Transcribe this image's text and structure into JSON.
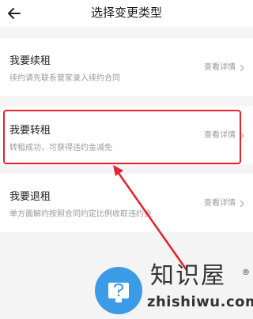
{
  "header": {
    "title": "选择变更类型",
    "back_icon": "arrow-left-icon"
  },
  "options": [
    {
      "title": "我要续租",
      "desc": "续约请先联系管家录入续约合同",
      "detail": "查看详情"
    },
    {
      "title": "我要转租",
      "desc": "转租成功，可获得违约金减免",
      "detail": "查看详情"
    },
    {
      "title": "我要退租",
      "desc": "单方面解约按照合同约定比例收取违约金",
      "detail": "查看详情"
    }
  ],
  "annotation": {
    "highlight_color": "#e8212c"
  },
  "watermark": {
    "name": "知识屋",
    "domain": "zhishiwu.com",
    "registered": "®"
  }
}
